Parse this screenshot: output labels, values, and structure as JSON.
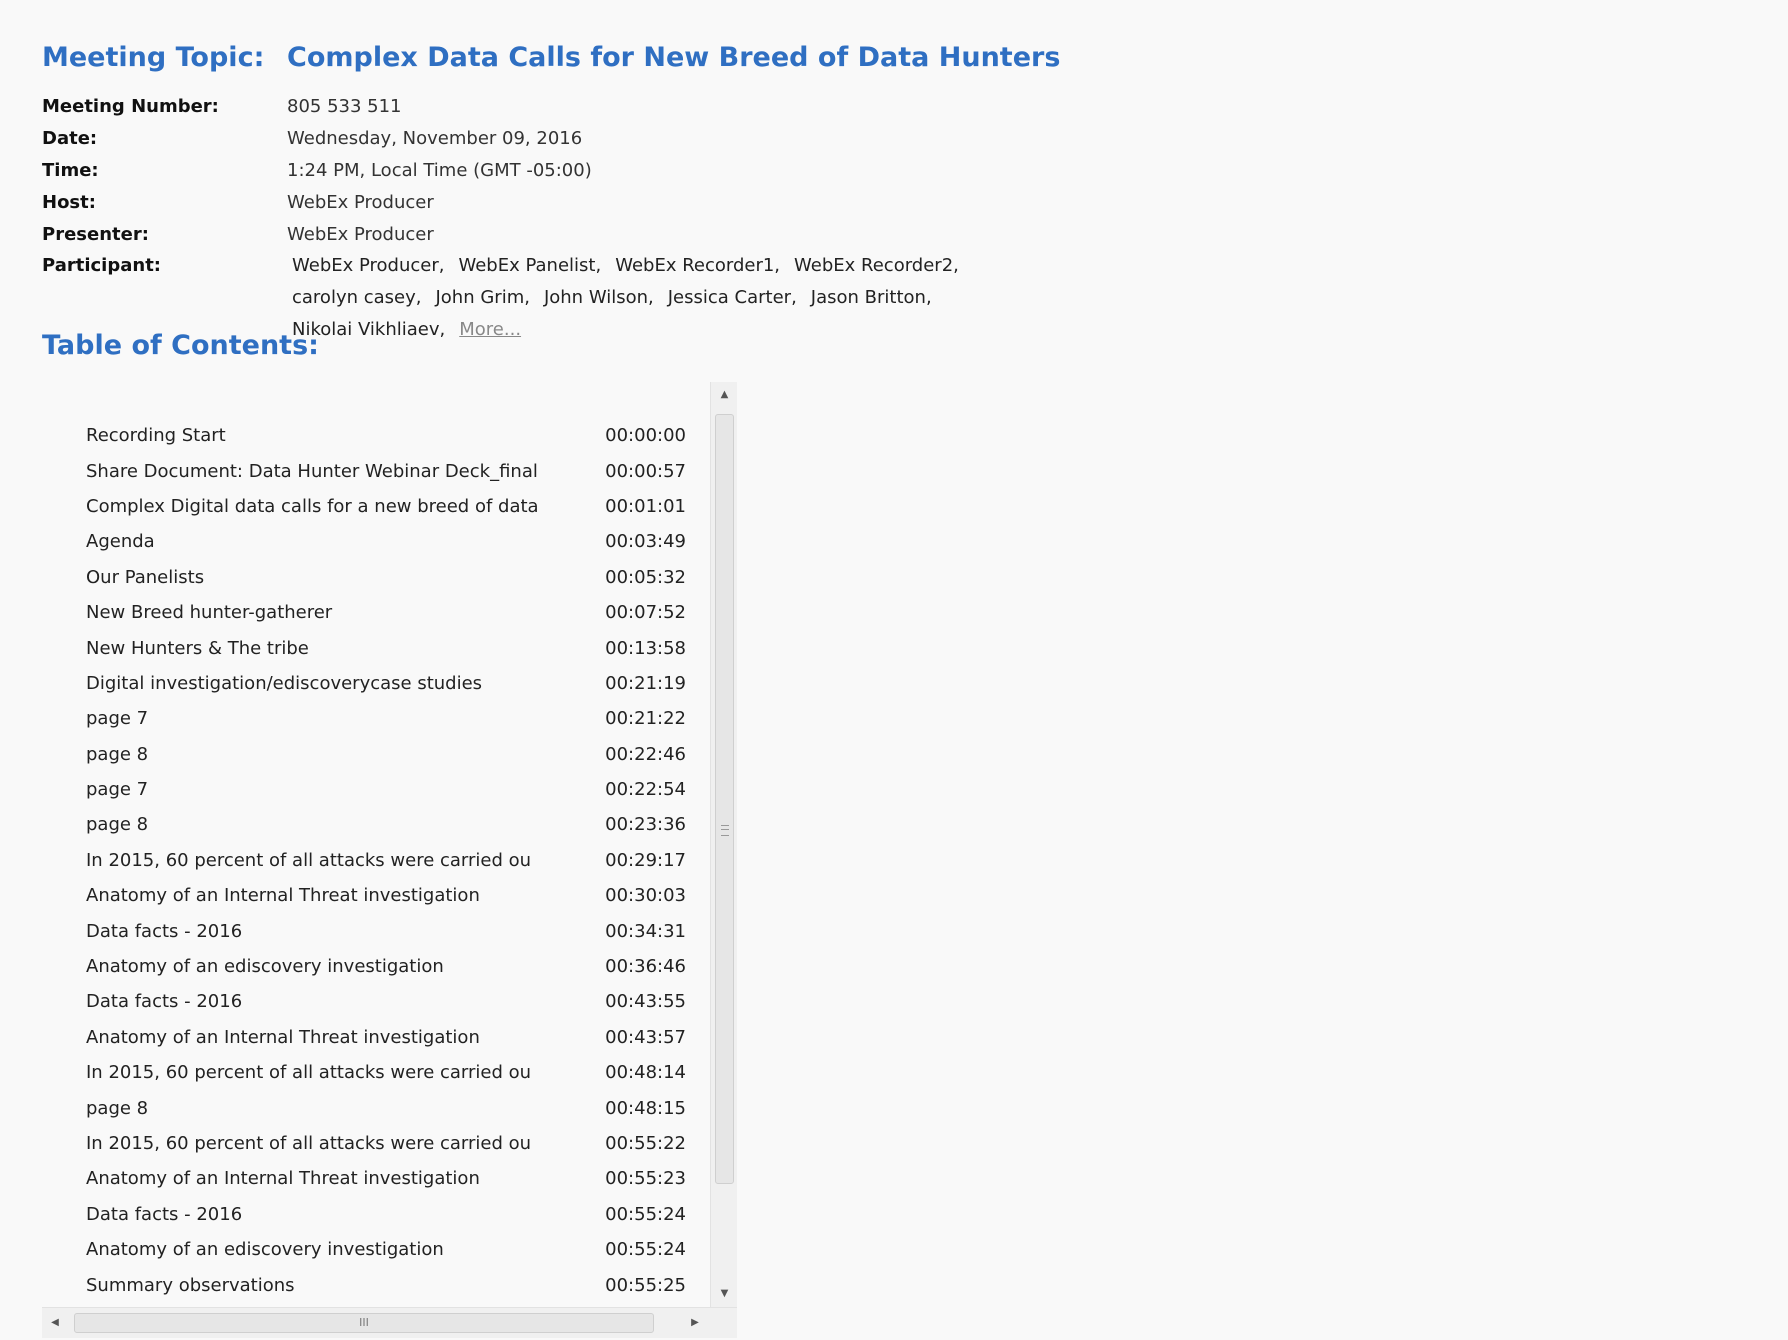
{
  "meeting": {
    "topic_label": "Meeting Topic:",
    "topic": "Complex Data Calls for New Breed of Data Hunters",
    "rows": [
      {
        "label": "Meeting Number:",
        "value": "805 533 511"
      },
      {
        "label": "Date:",
        "value": "Wednesday, November 09, 2016"
      },
      {
        "label": "Time:",
        "value": "1:24 PM, Local Time (GMT -05:00)"
      },
      {
        "label": "Host:",
        "value": "WebEx Producer"
      },
      {
        "label": "Presenter:",
        "value": "WebEx Producer"
      }
    ],
    "participant_label": "Participant:",
    "participants": [
      "WebEx Producer,",
      "WebEx Panelist,",
      "WebEx Recorder1,",
      "WebEx Recorder2,",
      "carolyn casey,",
      "John Grim,",
      "John Wilson,",
      "Jessica Carter,",
      "Jason Britton,",
      "Nikolai Vikhliaev,"
    ],
    "more_label": "More..."
  },
  "toc": {
    "title": "Table of Contents:",
    "items": [
      {
        "title": "Recording Start",
        "time": "00:00:00"
      },
      {
        "title": "Share Document: Data Hunter Webinar Deck_final",
        "time": "00:00:57"
      },
      {
        "title": "Complex Digital data calls for a new breed of data",
        "time": "00:01:01"
      },
      {
        "title": "Agenda",
        "time": "00:03:49"
      },
      {
        "title": "Our Panelists",
        "time": "00:05:32"
      },
      {
        "title": "New Breed hunter-gatherer",
        "time": "00:07:52"
      },
      {
        "title": "New Hunters & The tribe",
        "time": "00:13:58"
      },
      {
        "title": "Digital investigation/ediscoverycase studies",
        "time": "00:21:19"
      },
      {
        "title": "page 7",
        "time": "00:21:22"
      },
      {
        "title": "page 8",
        "time": "00:22:46"
      },
      {
        "title": "page 7",
        "time": "00:22:54"
      },
      {
        "title": "page 8",
        "time": "00:23:36"
      },
      {
        "title": "In 2015, 60 percent of all attacks were carried ou",
        "time": "00:29:17"
      },
      {
        "title": "Anatomy of an Internal Threat investigation",
        "time": "00:30:03"
      },
      {
        "title": "Data facts - 2016",
        "time": "00:34:31"
      },
      {
        "title": "Anatomy of an ediscovery investigation",
        "time": "00:36:46"
      },
      {
        "title": "Data facts - 2016",
        "time": "00:43:55"
      },
      {
        "title": "Anatomy of an Internal Threat investigation",
        "time": "00:43:57"
      },
      {
        "title": "In 2015, 60 percent of all attacks were carried ou",
        "time": "00:48:14"
      },
      {
        "title": "page 8",
        "time": "00:48:15"
      },
      {
        "title": "In 2015, 60 percent of all attacks were carried ou",
        "time": "00:55:22"
      },
      {
        "title": "Anatomy of an Internal Threat investigation",
        "time": "00:55:23"
      },
      {
        "title": "Data facts - 2016",
        "time": "00:55:24"
      },
      {
        "title": "Anatomy of an ediscovery investigation",
        "time": "00:55:24"
      },
      {
        "title": "Summary observations",
        "time": "00:55:25"
      }
    ]
  },
  "scrollbars": {
    "up_icon": "triangle-up-icon",
    "down_icon": "triangle-down-icon",
    "left_icon": "triangle-left-icon",
    "right_icon": "triangle-right-icon",
    "grip_icon": "grip-icon",
    "h_grip": "III"
  },
  "colors": {
    "heading": "#2f6fc2",
    "background": "#f9f9f9"
  }
}
